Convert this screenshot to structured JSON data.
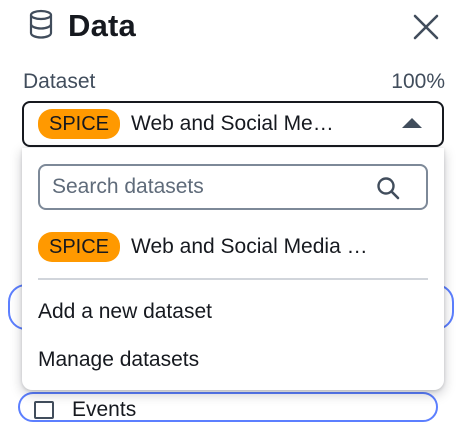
{
  "panel": {
    "title": "Data",
    "icon": "database-icon",
    "close_icon": "close-icon"
  },
  "dataset_field": {
    "label": "Dataset",
    "usage": "100%",
    "selected": {
      "badge": "SPICE",
      "name": "Web and Social Me…"
    }
  },
  "dropdown": {
    "search_placeholder": "Search datasets",
    "options": [
      {
        "badge": "SPICE",
        "name": "Web and Social Media …"
      }
    ],
    "actions": [
      {
        "label": "Add a new dataset"
      },
      {
        "label": "Manage datasets"
      }
    ]
  },
  "background": {
    "partial_item_label": "Events"
  },
  "colors": {
    "badge_bg": "#ff9900",
    "text": "#16191f",
    "border_focus": "#16191f",
    "accent_outline": "#5c7fff"
  }
}
